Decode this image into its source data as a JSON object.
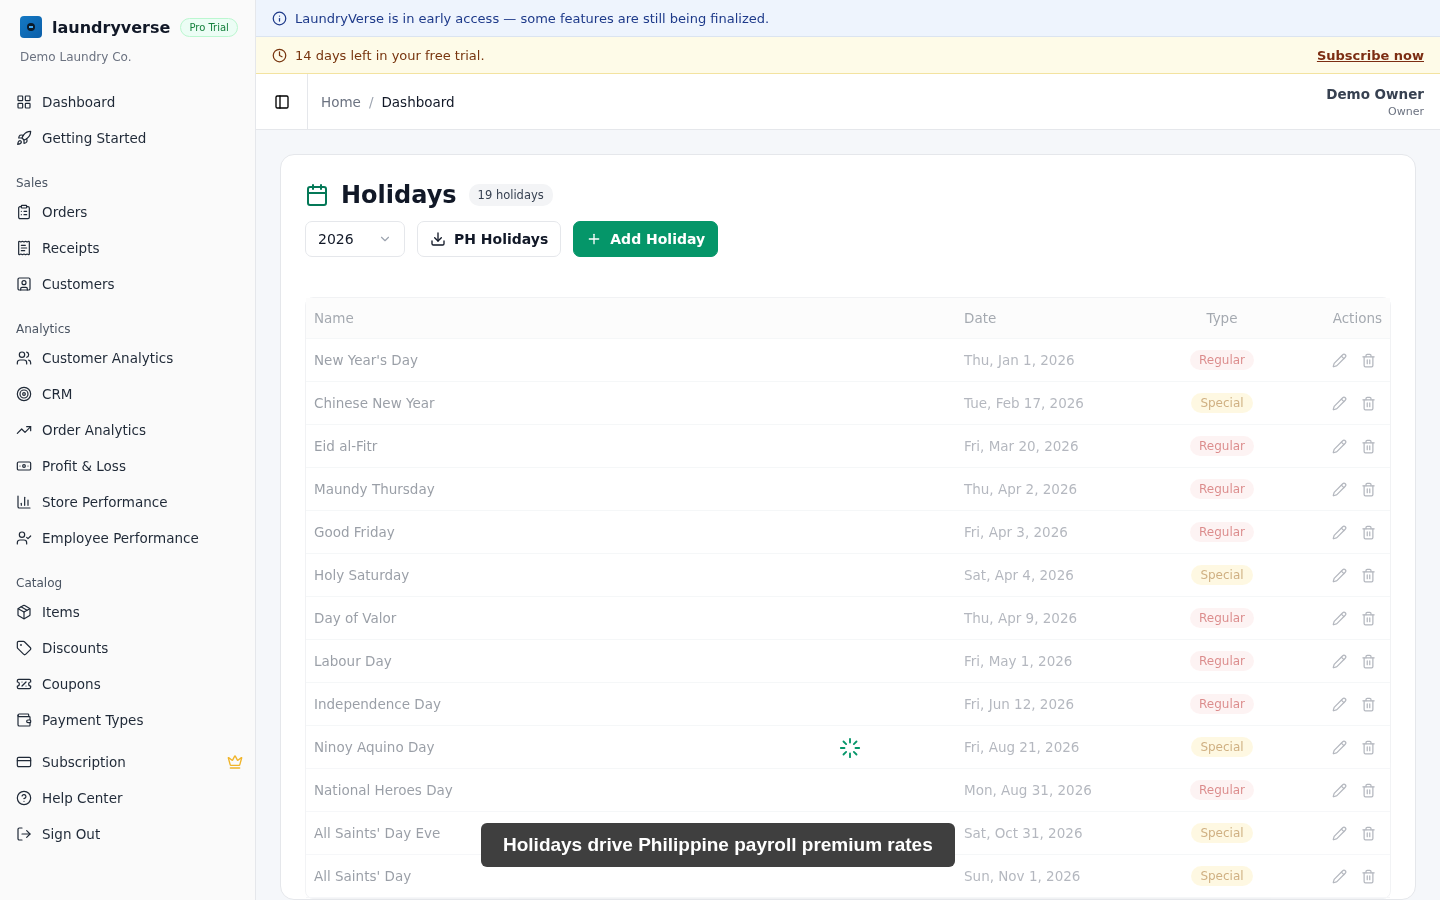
{
  "brand": {
    "name": "laundryverse",
    "plan": "Pro Trial",
    "company": "Demo Laundry Co."
  },
  "sidebar": {
    "top": [
      {
        "label": "Dashboard",
        "selected": false
      },
      {
        "label": "Getting Started",
        "selected": false
      }
    ],
    "sections": [
      {
        "title": "Sales",
        "items": [
          {
            "label": "Orders"
          },
          {
            "label": "Receipts"
          },
          {
            "label": "Customers"
          }
        ]
      },
      {
        "title": "Analytics",
        "items": [
          {
            "label": "Customer Analytics"
          },
          {
            "label": "CRM"
          },
          {
            "label": "Order Analytics"
          },
          {
            "label": "Profit & Loss"
          },
          {
            "label": "Store Performance"
          },
          {
            "label": "Employee Performance"
          }
        ]
      },
      {
        "title": "Catalog",
        "items": [
          {
            "label": "Items"
          },
          {
            "label": "Discounts"
          },
          {
            "label": "Coupons"
          },
          {
            "label": "Payment Types"
          }
        ]
      }
    ],
    "bottom": [
      {
        "label": "Subscription",
        "premium": true
      },
      {
        "label": "Help Center",
        "premium": false
      },
      {
        "label": "Sign Out",
        "premium": false
      }
    ]
  },
  "info_banner": "LaundryVerse is in early access — some features are still being finalized.",
  "trial_banner": {
    "text": "14 days left in your free trial.",
    "link": "Subscribe now"
  },
  "breadcrumb": [
    "Home",
    "Dashboard"
  ],
  "breadcrumb_separator": "/",
  "user": {
    "name": "Demo Owner",
    "role": "Owner"
  },
  "page": {
    "title": "Holidays",
    "count": "19 holidays",
    "year": "2026",
    "import_button": "PH Holidays",
    "add_button": "Add Holiday"
  },
  "table": {
    "loading": true,
    "columns": [
      "Name",
      "Date",
      "Type",
      "Actions"
    ],
    "rows": [
      {
        "name": "New Year's Day",
        "date": "Thu, Jan 1, 2026",
        "type": "Regular",
        "kind": "regular"
      },
      {
        "name": "Chinese New Year",
        "date": "Tue, Feb 17, 2026",
        "type": "Special",
        "kind": "special"
      },
      {
        "name": "Eid al-Fitr",
        "date": "Fri, Mar 20, 2026",
        "type": "Regular",
        "kind": "regular"
      },
      {
        "name": "Maundy Thursday",
        "date": "Thu, Apr 2, 2026",
        "type": "Regular",
        "kind": "regular"
      },
      {
        "name": "Good Friday",
        "date": "Fri, Apr 3, 2026",
        "type": "Regular",
        "kind": "regular"
      },
      {
        "name": "Holy Saturday",
        "date": "Sat, Apr 4, 2026",
        "type": "Special",
        "kind": "special"
      },
      {
        "name": "Day of Valor",
        "date": "Thu, Apr 9, 2026",
        "type": "Regular",
        "kind": "regular"
      },
      {
        "name": "Labour Day",
        "date": "Fri, May 1, 2026",
        "type": "Regular",
        "kind": "regular"
      },
      {
        "name": "Independence Day",
        "date": "Fri, Jun 12, 2026",
        "type": "Regular",
        "kind": "regular"
      },
      {
        "name": "Ninoy Aquino Day",
        "date": "Fri, Aug 21, 2026",
        "type": "Special",
        "kind": "special"
      },
      {
        "name": "National Heroes Day",
        "date": "Mon, Aug 31, 2026",
        "type": "Regular",
        "kind": "regular"
      },
      {
        "name": "All Saints' Day Eve",
        "date": "Sat, Oct 31, 2026",
        "type": "Special",
        "kind": "special"
      },
      {
        "name": "All Saints' Day",
        "date": "Sun, Nov 1, 2026",
        "type": "Special",
        "kind": "special"
      }
    ]
  },
  "toast": "Holidays drive Philippine payroll premium rates"
}
